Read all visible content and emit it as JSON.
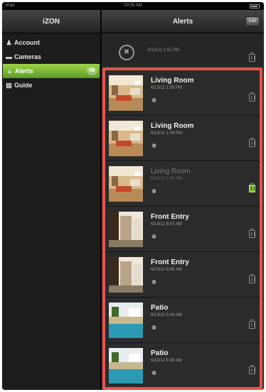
{
  "status_bar": {
    "carrier": "iPad",
    "time": "10:35 AM"
  },
  "sidebar": {
    "title": "iZON",
    "items": [
      {
        "label": "Account",
        "icon": "person-icon"
      },
      {
        "label": "Cameras",
        "icon": "camera-icon"
      },
      {
        "label": "Alerts",
        "icon": "bell-icon",
        "badge": "46",
        "active": true
      },
      {
        "label": "Guide",
        "icon": "book-icon"
      }
    ]
  },
  "main": {
    "title": "Alerts",
    "edit_label": "Edit",
    "top_row": {
      "timestamp": "6/13/12 1:55 PM"
    },
    "alerts": [
      {
        "room": "Living Room",
        "date": "6/13/12 1:05 PM",
        "viewed": false,
        "thumb": "room"
      },
      {
        "room": "Living Room",
        "date": "6/13/12 1:04 PM",
        "viewed": false,
        "thumb": "room"
      },
      {
        "room": "Living Room",
        "date": "6/13/12 1:03 PM",
        "viewed": true,
        "thumb": "room"
      },
      {
        "room": "Front Entry",
        "date": "6/13/12 8:47 AM",
        "viewed": false,
        "thumb": "entry"
      },
      {
        "room": "Front Entry",
        "date": "6/13/12 8:45 AM",
        "viewed": false,
        "thumb": "entry"
      },
      {
        "room": "Patio",
        "date": "6/13/12 8:44 AM",
        "viewed": false,
        "thumb": "patio"
      },
      {
        "room": "Patio",
        "date": "6/13/12 8:36 AM",
        "viewed": false,
        "thumb": "patio"
      }
    ]
  },
  "colors": {
    "accent_green": "#7ac23a",
    "highlight_red": "#e8534d"
  }
}
